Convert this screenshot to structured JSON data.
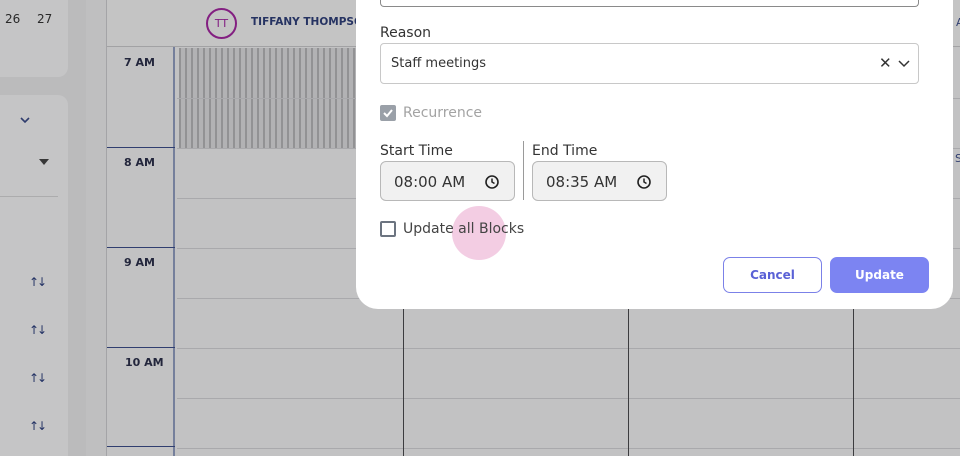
{
  "mini_calendar": {
    "days": [
      "26",
      "27"
    ]
  },
  "scheduler": {
    "provider": {
      "initials": "TT",
      "name": "TIFFANY THOMPSON"
    },
    "time_slots": [
      "7 AM",
      "8 AM",
      "9 AM",
      "10 AM"
    ],
    "edge_letters": [
      "A",
      "S"
    ]
  },
  "dialog": {
    "reason": {
      "label": "Reason",
      "value": "Staff meetings"
    },
    "recurrence": {
      "label": "Recurrence",
      "checked": true,
      "disabled": true
    },
    "start_time": {
      "label": "Start Time",
      "value": "08:00 AM"
    },
    "end_time": {
      "label": "End Time",
      "value": "08:35 AM"
    },
    "update_all": {
      "label": "Update all Blocks",
      "checked": false
    },
    "buttons": {
      "cancel": "Cancel",
      "update": "Update"
    }
  },
  "colors": {
    "accent": "#7c84f2",
    "avatar_ring": "#a0269e",
    "ripple": "#e282b8"
  }
}
